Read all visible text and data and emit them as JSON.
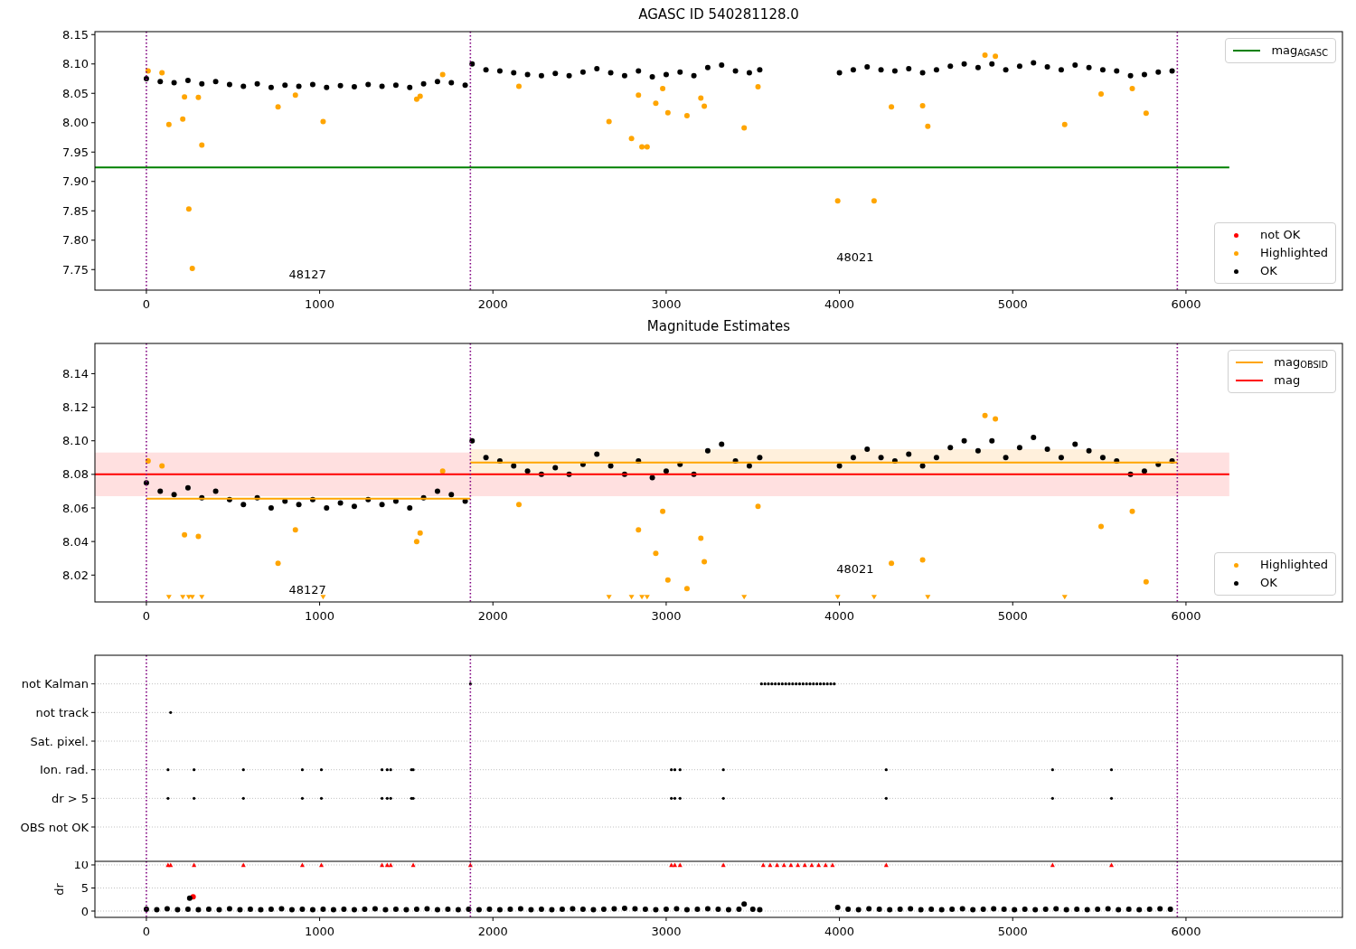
{
  "panels": [
    {
      "chart_data": {
        "type": "scatter",
        "title": "AGASC ID 540281128.0",
        "xlim": [
          -297,
          6903
        ],
        "ylim": [
          7.715,
          8.155
        ],
        "xticks": [
          0,
          1000,
          2000,
          3000,
          4000,
          5000,
          6000
        ],
        "yticks": [
          {
            "value": 7.75,
            "label": "7.75"
          },
          {
            "value": 7.8,
            "label": "7.80"
          },
          {
            "value": 7.85,
            "label": "7.85"
          },
          {
            "value": 7.9,
            "label": "7.90"
          },
          {
            "value": 7.95,
            "label": "7.95"
          },
          {
            "value": 8.0,
            "label": "8.00"
          },
          {
            "value": 8.05,
            "label": "8.05"
          },
          {
            "value": 8.1,
            "label": "8.10"
          },
          {
            "value": 8.15,
            "label": "8.15"
          }
        ],
        "series": [
          {
            "name": "mag$_{AGASC}$",
            "type": "line",
            "color": "#008000",
            "x": [
              -297,
              6250
            ],
            "values": [
              7.924,
              7.924
            ]
          },
          {
            "name": "not OK",
            "type": "scatter",
            "marker": "circle",
            "color": "#ff0000",
            "x": [
              null
            ],
            "values": [
              null
            ]
          },
          {
            "name": "Highlighted",
            "type": "scatter",
            "marker": "circle",
            "color": "#ffa500",
            "x": [
              10,
              90,
              130,
              210,
              220,
              245,
              265,
              300,
              320,
              760,
              860,
              1020,
              1560,
              1580,
              1710,
              2150,
              2670,
              2800,
              2840,
              2860,
              2890,
              2940,
              2980,
              3010,
              3120,
              3200,
              3220,
              3450,
              3530,
              3990,
              4200,
              4300,
              4480,
              4510,
              4840,
              4900,
              5300,
              5510,
              5690,
              5770
            ],
            "values": [
              8.088,
              8.085,
              7.997,
              8.006,
              8.044,
              7.853,
              7.752,
              8.043,
              7.962,
              8.027,
              8.047,
              8.002,
              8.04,
              8.045,
              8.082,
              8.062,
              8.002,
              7.973,
              8.047,
              7.959,
              7.959,
              8.033,
              8.058,
              8.017,
              8.012,
              8.042,
              8.028,
              7.991,
              8.061,
              7.867,
              7.867,
              8.027,
              8.029,
              7.994,
              8.115,
              8.113,
              7.997,
              8.049,
              8.058,
              8.016
            ]
          },
          {
            "name": "OK",
            "type": "scatter",
            "marker": "circle",
            "color": "#000000",
            "x": [
              0,
              80,
              160,
              240,
              320,
              400,
              480,
              560,
              640,
              720,
              800,
              880,
              960,
              1040,
              1120,
              1200,
              1280,
              1360,
              1440,
              1520,
              1600,
              1680,
              1760,
              1840,
              1880,
              1960,
              2040,
              2120,
              2200,
              2280,
              2360,
              2440,
              2520,
              2600,
              2680,
              2760,
              2840,
              2920,
              3000,
              3080,
              3160,
              3240,
              3320,
              3400,
              3480,
              3540,
              4000,
              4080,
              4160,
              4240,
              4320,
              4400,
              4480,
              4560,
              4640,
              4720,
              4800,
              4880,
              4960,
              5040,
              5120,
              5200,
              5280,
              5360,
              5440,
              5520,
              5600,
              5680,
              5760,
              5840,
              5920
            ],
            "values": [
              8.075,
              8.07,
              8.068,
              8.072,
              8.066,
              8.07,
              8.065,
              8.062,
              8.066,
              8.06,
              8.064,
              8.062,
              8.065,
              8.06,
              8.063,
              8.061,
              8.065,
              8.062,
              8.064,
              8.06,
              8.066,
              8.07,
              8.068,
              8.064,
              8.1,
              8.09,
              8.088,
              8.085,
              8.082,
              8.08,
              8.084,
              8.08,
              8.086,
              8.092,
              8.085,
              8.08,
              8.088,
              8.078,
              8.082,
              8.086,
              8.08,
              8.094,
              8.098,
              8.088,
              8.085,
              8.09,
              8.085,
              8.09,
              8.095,
              8.09,
              8.088,
              8.092,
              8.085,
              8.09,
              8.096,
              8.1,
              8.094,
              8.1,
              8.09,
              8.096,
              8.102,
              8.095,
              8.09,
              8.098,
              8.094,
              8.09,
              8.088,
              8.08,
              8.082,
              8.086,
              8.088
            ]
          }
        ],
        "ref_lines": [
          {
            "axis": "x",
            "value": 0,
            "color": "#800080"
          },
          {
            "axis": "x",
            "value": 1870,
            "color": "#800080"
          },
          {
            "axis": "x",
            "value": 5950,
            "color": "#800080"
          }
        ],
        "annotations": [
          "48127",
          "48021"
        ]
      }
    },
    {
      "chart_data": {
        "type": "scatter",
        "title": "Magnitude Estimates",
        "xlim": [
          -297,
          6903
        ],
        "ylim": [
          8.004,
          8.158
        ],
        "xticks": [
          0,
          1000,
          2000,
          3000,
          4000,
          5000,
          6000
        ],
        "yticks": [
          {
            "value": 8.02,
            "label": "8.02"
          },
          {
            "value": 8.04,
            "label": "8.04"
          },
          {
            "value": 8.06,
            "label": "8.06"
          },
          {
            "value": 8.08,
            "label": "8.08"
          },
          {
            "value": 8.1,
            "label": "8.10"
          },
          {
            "value": 8.12,
            "label": "8.12"
          },
          {
            "value": 8.14,
            "label": "8.14"
          }
        ],
        "bands": [
          {
            "axis": "y",
            "from": 8.067,
            "to": 8.093,
            "color": "#ffe0e0"
          },
          {
            "axis": "y",
            "from": 8.079,
            "to": 8.095,
            "color": "#fff0dc"
          }
        ],
        "series": [
          {
            "name": "mag$_{OBSID}$",
            "type": "line",
            "color": "#ffa500",
            "x": [
              0,
              1870,
              null,
              1870,
              5950
            ],
            "values": [
              8.0655,
              8.0655,
              null,
              8.087,
              8.087
            ]
          },
          {
            "name": "mag",
            "type": "line",
            "color": "#ff0000",
            "x": [
              -297,
              6250
            ],
            "values": [
              8.08,
              8.08
            ]
          },
          {
            "name": "Highlighted",
            "type": "scatter",
            "marker": "circle",
            "color": "#ffa500",
            "x": [
              10,
              90,
              220,
              300,
              760,
              860,
              1560,
              1580,
              1710,
              2150,
              2840,
              2940,
              2980,
              3010,
              3120,
              3200,
              3220,
              3530,
              4300,
              4480,
              4840,
              4900,
              5510,
              5690,
              5770
            ],
            "values": [
              8.088,
              8.085,
              8.044,
              8.043,
              8.027,
              8.047,
              8.04,
              8.045,
              8.082,
              8.062,
              8.047,
              8.033,
              8.058,
              8.017,
              8.012,
              8.042,
              8.028,
              8.061,
              8.027,
              8.029,
              8.115,
              8.113,
              8.049,
              8.058,
              8.016
            ]
          },
          {
            "name": "OK",
            "type": "scatter",
            "marker": "circle",
            "color": "#000000",
            "x": [
              0,
              80,
              160,
              240,
              320,
              400,
              480,
              560,
              640,
              720,
              800,
              880,
              960,
              1040,
              1120,
              1200,
              1280,
              1360,
              1440,
              1520,
              1600,
              1680,
              1760,
              1840,
              1880,
              1960,
              2040,
              2120,
              2200,
              2280,
              2360,
              2440,
              2520,
              2600,
              2680,
              2760,
              2840,
              2920,
              3000,
              3080,
              3160,
              3240,
              3320,
              3400,
              3480,
              3540,
              4000,
              4080,
              4160,
              4240,
              4320,
              4400,
              4480,
              4560,
              4640,
              4720,
              4800,
              4880,
              4960,
              5040,
              5120,
              5200,
              5280,
              5360,
              5440,
              5520,
              5600,
              5680,
              5760,
              5840,
              5920
            ],
            "values": [
              8.075,
              8.07,
              8.068,
              8.072,
              8.066,
              8.07,
              8.065,
              8.062,
              8.066,
              8.06,
              8.064,
              8.062,
              8.065,
              8.06,
              8.063,
              8.061,
              8.065,
              8.062,
              8.064,
              8.06,
              8.066,
              8.07,
              8.068,
              8.064,
              8.1,
              8.09,
              8.088,
              8.085,
              8.082,
              8.08,
              8.084,
              8.08,
              8.086,
              8.092,
              8.085,
              8.08,
              8.088,
              8.078,
              8.082,
              8.086,
              8.08,
              8.094,
              8.098,
              8.088,
              8.085,
              8.09,
              8.085,
              8.09,
              8.095,
              8.09,
              8.088,
              8.092,
              8.085,
              8.09,
              8.096,
              8.1,
              8.094,
              8.1,
              8.09,
              8.096,
              8.102,
              8.095,
              8.09,
              8.098,
              8.094,
              8.09,
              8.088,
              8.08,
              8.082,
              8.086,
              8.088
            ]
          },
          {
            "type": "scatter",
            "marker": "triangle",
            "color": "#ffa500",
            "x": [
              130,
              210,
              245,
              265,
              320,
              1020,
              2670,
              2800,
              2860,
              2890,
              3450,
              3990,
              4200,
              4510,
              5300
            ],
            "values": [
              8.0065,
              8.0065,
              8.0065,
              8.0065,
              8.0065,
              8.0065,
              8.0065,
              8.0065,
              8.0065,
              8.0065,
              8.0065,
              8.0065,
              8.0065,
              8.0065,
              8.0065
            ]
          }
        ],
        "ref_lines": [
          {
            "axis": "x",
            "value": 0,
            "color": "#800080"
          },
          {
            "axis": "x",
            "value": 1870,
            "color": "#800080"
          },
          {
            "axis": "x",
            "value": 5950,
            "color": "#800080"
          }
        ],
        "annotations": [
          "48127",
          "48021"
        ]
      }
    },
    {
      "flag_rows": [
        {
          "label": "not Kalman"
        },
        {
          "label": "not track"
        },
        {
          "label": "Sat. pixel."
        },
        {
          "label": "Ion. rad."
        },
        {
          "label": "dr > 5"
        },
        {
          "label": "OBS not OK"
        }
      ]
    },
    {
      "chart_data": {
        "type": "scatter",
        "grid": true,
        "ylabel": "dr",
        "xlim": [
          -297,
          6903
        ],
        "ylim": [
          -1.37,
          10.78
        ],
        "xticks": [
          0,
          1000,
          2000,
          3000,
          4000,
          5000,
          6000
        ],
        "yticks": [
          0,
          5,
          10
        ],
        "series": [
          {
            "type": "scatter",
            "marker": "triangle",
            "color": "#ff0000",
            "x": [
              125,
              140,
              275,
              560,
              900,
              1010,
              1360,
              1390,
              1410,
              1530,
              1540,
              1870,
              3030,
              3050,
              3080,
              3330,
              3560,
              3600,
              3640,
              3680,
              3720,
              3760,
              3800,
              3840,
              3880,
              3920,
              3960,
              4270,
              5230,
              5570
            ],
            "values": [
              10,
              10,
              10,
              10,
              10,
              10,
              10,
              10,
              10,
              null,
              10,
              10,
              10,
              10,
              10,
              10,
              10,
              10,
              10,
              10,
              10,
              10,
              10,
              10,
              10,
              10,
              10,
              10,
              10,
              10
            ]
          },
          {
            "type": "scatter",
            "marker": "circle",
            "color": "#ff0000",
            "x": [
              270
            ],
            "values": [
              3.1
            ]
          },
          {
            "type": "scatter",
            "marker": "circle",
            "color": "#000000",
            "x": [
              0,
              60,
              120,
              180,
              240,
              250,
              300,
              360,
              420,
              480,
              540,
              600,
              660,
              720,
              780,
              840,
              900,
              960,
              1020,
              1080,
              1140,
              1200,
              1260,
              1320,
              1380,
              1440,
              1500,
              1560,
              1620,
              1680,
              1740,
              1800,
              1860,
              1920,
              1980,
              2040,
              2100,
              2160,
              2220,
              2280,
              2340,
              2400,
              2460,
              2520,
              2580,
              2640,
              2700,
              2760,
              2820,
              2880,
              2940,
              3000,
              3060,
              3120,
              3180,
              3240,
              3300,
              3360,
              3420,
              3450,
              3500,
              3540,
              3990,
              4050,
              4110,
              4170,
              4230,
              4290,
              4350,
              4410,
              4470,
              4530,
              4590,
              4650,
              4710,
              4770,
              4830,
              4890,
              4950,
              5010,
              5070,
              5130,
              5190,
              5250,
              5310,
              5370,
              5430,
              5490,
              5550,
              5610,
              5670,
              5730,
              5790,
              5850,
              5910
            ],
            "values": [
              0.4,
              0.3,
              0.5,
              0.3,
              0.4,
              2.8,
              0.3,
              0.4,
              0.3,
              0.5,
              0.3,
              0.4,
              0.3,
              0.4,
              0.5,
              0.3,
              0.4,
              0.3,
              0.4,
              0.3,
              0.4,
              0.3,
              0.4,
              0.5,
              0.3,
              0.4,
              0.3,
              0.4,
              0.5,
              0.3,
              0.4,
              0.3,
              0.4,
              0.3,
              0.4,
              0.3,
              0.4,
              0.5,
              0.3,
              0.4,
              0.3,
              0.4,
              0.5,
              0.4,
              0.3,
              0.4,
              0.5,
              0.6,
              0.5,
              0.4,
              0.3,
              0.4,
              0.5,
              0.3,
              0.4,
              0.5,
              0.4,
              0.3,
              0.4,
              1.5,
              0.4,
              0.3,
              0.8,
              0.4,
              0.3,
              0.5,
              0.4,
              0.3,
              0.4,
              0.5,
              0.3,
              0.4,
              0.3,
              0.4,
              0.5,
              0.3,
              0.4,
              0.5,
              0.4,
              0.3,
              0.4,
              0.3,
              0.4,
              0.5,
              0.3,
              0.4,
              0.3,
              0.4,
              0.5,
              0.3,
              0.4,
              0.3,
              0.4,
              0.5,
              0.4
            ]
          }
        ],
        "ref_lines": [
          {
            "axis": "x",
            "value": 0,
            "color": "#800080"
          },
          {
            "axis": "x",
            "value": 1870,
            "color": "#800080"
          },
          {
            "axis": "x",
            "value": 5950,
            "color": "#800080"
          }
        ]
      }
    }
  ]
}
